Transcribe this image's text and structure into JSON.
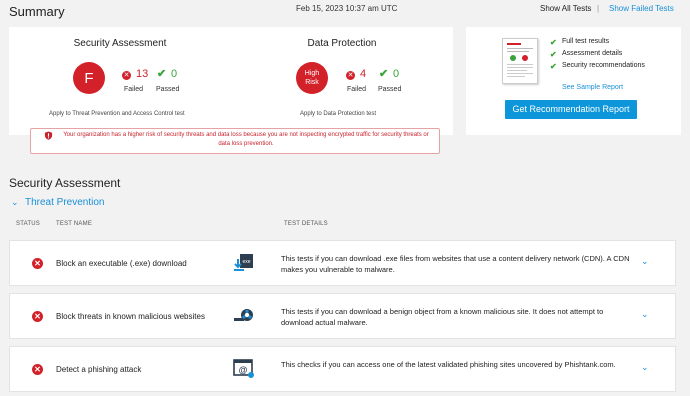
{
  "header": {
    "title": "Summary",
    "date": "Feb 15, 2023 10:37 am UTC",
    "show_all": "Show All Tests",
    "separator": "|",
    "show_failed": "Show Failed Tests"
  },
  "summary": {
    "security": {
      "title": "Security Assessment",
      "grade": "F",
      "failed_count": "13",
      "failed_label": "Failed",
      "passed_count": "0",
      "passed_label": "Passed",
      "apply": "Apply to Threat Prevention and Access Control test"
    },
    "data_protection": {
      "title": "Data Protection",
      "grade_line1": "High",
      "grade_line2": "Risk",
      "failed_count": "4",
      "failed_label": "Failed",
      "passed_count": "0",
      "passed_label": "Passed",
      "apply": "Apply to Data Protection test"
    },
    "alert": "Your organization has a higher risk of security threats and data loss because you are not inspecting encrypted traffic for security threats or data loss prevention."
  },
  "report": {
    "bullets": [
      "Full test results",
      "Assessment details",
      "Security recommendations"
    ],
    "sample_link": "See Sample Report",
    "button": "Get Recommendation Report"
  },
  "assessment": {
    "title": "Security Assessment",
    "section": "Threat Prevention",
    "columns": {
      "status": "STATUS",
      "name": "TEST NAME",
      "details": "TEST DETAILS"
    },
    "rows": [
      {
        "name": "Block an executable (.exe) download",
        "detail": "This tests if you can download .exe files from websites that use a content delivery network (CDN). A CDN makes you vulnerable to malware.",
        "icon": "download-exe-icon"
      },
      {
        "name": "Block threats in known malicious websites",
        "detail": "This tests if you can download a benign object from a known malicious site. It does not attempt to download actual malware.",
        "icon": "biohazard-icon"
      },
      {
        "name": "Detect a phishing attack",
        "detail": "This checks if you can access one of the latest validated phishing sites uncovered by Phishtank.com.",
        "icon": "phishing-at-icon"
      }
    ]
  },
  "colors": {
    "accent": "#1a90d8",
    "fail": "#d3212a",
    "pass": "#3aa33a",
    "button": "#0d96d9"
  }
}
